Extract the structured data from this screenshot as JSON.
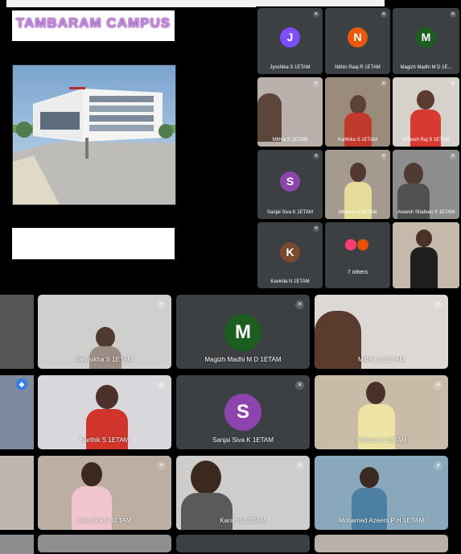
{
  "presentation": {
    "title": "TAMBARAM CAMPUS",
    "caption": ""
  },
  "grid": [
    {
      "name": "Jyoshika S 1ETAM",
      "initial": "J",
      "color": "#7c4dff",
      "video": false
    },
    {
      "name": "Nithin Raaj R 1ETAM",
      "initial": "N",
      "color": "#e8590c",
      "video": false
    },
    {
      "name": "Magizh Madhi M D 1E...",
      "initial": "M",
      "color": "#1b5e20",
      "video": false
    },
    {
      "name": "Mithra S 1ETAM",
      "initial": "",
      "color": "#8b7c74",
      "video": true
    },
    {
      "name": "Karthika S 1ETAM",
      "initial": "",
      "color": "#7b6050",
      "video": true
    },
    {
      "name": "Srinesh Raj S 1ETAM",
      "initial": "",
      "color": "#b8b2ad",
      "video": true
    },
    {
      "name": "Sanjai Siva K 1ETAM",
      "initial": "S",
      "color": "#8e44ad",
      "video": false
    },
    {
      "name": "Mithuna A 1ETAM",
      "initial": "",
      "color": "#9a8e7e",
      "video": true
    },
    {
      "name": "Aneesh Shafeen S 1ETAM",
      "initial": "",
      "color": "#8a8a8a",
      "video": true
    },
    {
      "name": "Kavinila N 1ETAM",
      "initial": "K",
      "color": "#7a4a2e",
      "video": false
    },
    {
      "name": "7 others",
      "initial": "",
      "color": "#3c4043",
      "video": false
    },
    {
      "name": "",
      "initial": "",
      "color": "#c8bfb3",
      "video": true
    }
  ],
  "bottom": [
    {
      "name": "Devisikha S 1ETAM",
      "initial": "",
      "color": "#c9c9c7",
      "video": true
    },
    {
      "name": "Magizh Madhi M D 1ETAM",
      "initial": "M",
      "color": "#1b5e20",
      "video": false
    },
    {
      "name": "Mithra S 1ETAM",
      "initial": "",
      "color": "#d6d0cc",
      "video": true
    },
    {
      "name": "Karthik S 1ETAM",
      "initial": "",
      "color": "#c8c8cc",
      "video": true
    },
    {
      "name": "Sanjai Siva K 1ETAM",
      "initial": "S",
      "color": "#8e44ad",
      "video": false
    },
    {
      "name": "Mithuna A 1ETAM",
      "initial": "",
      "color": "#b9ad98",
      "video": true
    },
    {
      "name": "Aasmika N 1ETAM",
      "initial": "",
      "color": "#b1a79d",
      "video": true
    },
    {
      "name": "Karan S 1ETAM",
      "initial": "",
      "color": "#c4c2c0",
      "video": true
    },
    {
      "name": "Mohamed Azeem P H 1ETAM",
      "initial": "",
      "color": "#7aa0b8",
      "video": true
    }
  ],
  "icons": {
    "mic": "mic-off-icon",
    "others": "people-icon",
    "pin": "pin-icon"
  },
  "colors": {
    "background": "#000000",
    "tile": "#3c4043",
    "accent": "#c58be0"
  }
}
